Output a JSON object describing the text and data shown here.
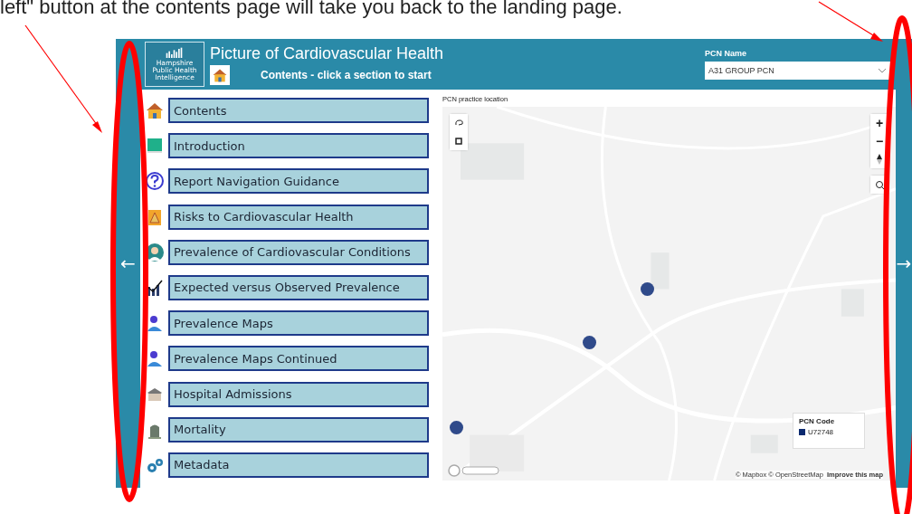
{
  "caption": "left\" button at the contents page will take you back to the landing page.",
  "report": {
    "title": "Picture of Cardiovascular Health",
    "subtitle": "Contents - click a section to start",
    "logo_text": "Hampshire Public Health Intelligence",
    "filter": {
      "label": "PCN Name",
      "value": "A31 GROUP PCN"
    },
    "nav": {
      "back": "←",
      "next": "→"
    },
    "sections": [
      {
        "label": "Contents"
      },
      {
        "label": "Introduction"
      },
      {
        "label": "Report Navigation Guidance"
      },
      {
        "label": "Risks to Cardiovascular Health"
      },
      {
        "label": "Prevalence of Cardiovascular Conditions"
      },
      {
        "label": "Expected versus Observed Prevalence"
      },
      {
        "label": "Prevalence Maps"
      },
      {
        "label": "Prevalence Maps Continued"
      },
      {
        "label": "Hospital Admissions"
      },
      {
        "label": "Mortality"
      },
      {
        "label": "Metadata"
      }
    ],
    "map": {
      "title": "PCN practice location",
      "zoom_in": "+",
      "zoom_out": "−",
      "legend": {
        "title": "PCN Code",
        "items": [
          {
            "label": "U72748",
            "color": "#0b2a6f"
          }
        ]
      },
      "attribution": "© Mapbox © OpenStreetMap",
      "improve": "Improve this map"
    }
  }
}
